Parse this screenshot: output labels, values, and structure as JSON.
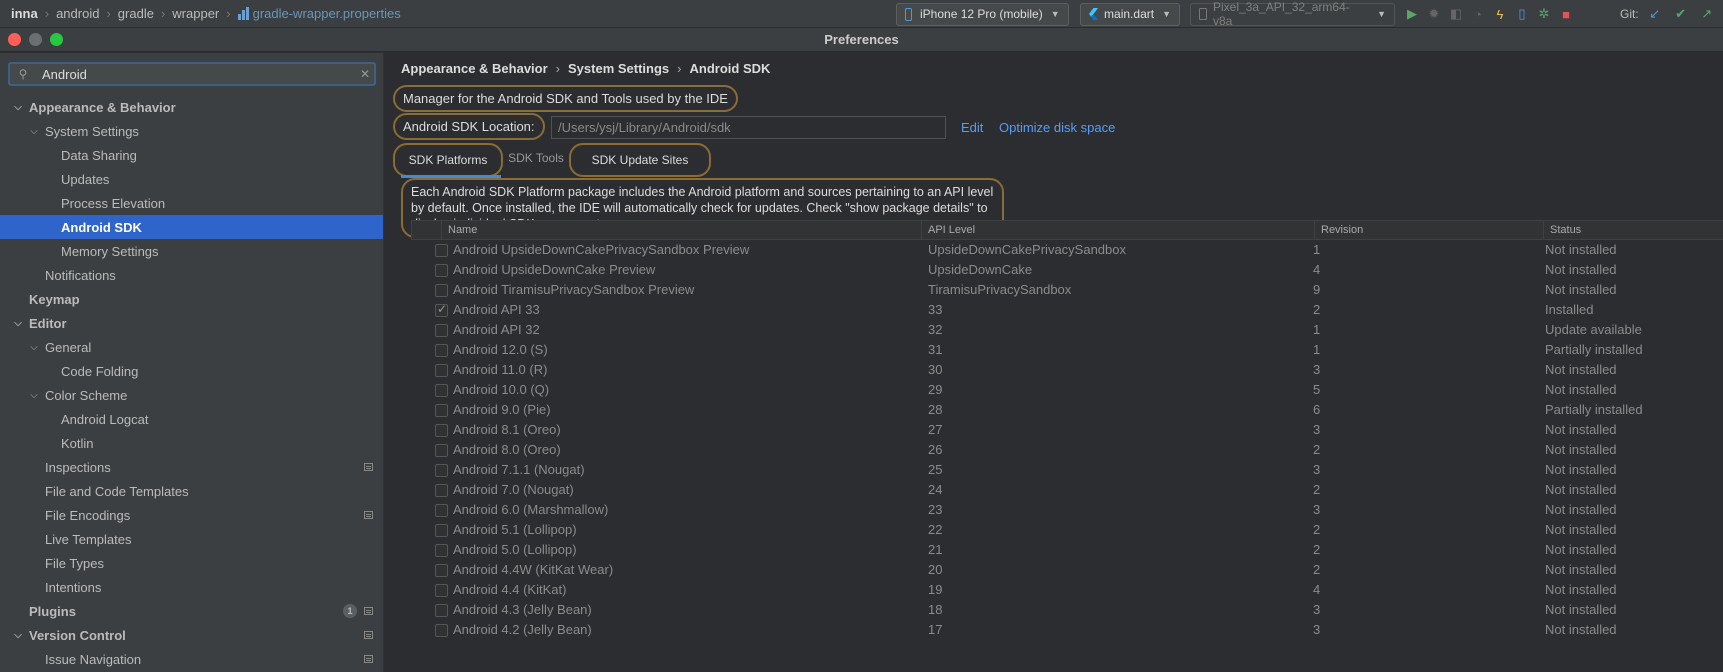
{
  "topbar": {
    "breadcrumbs": [
      "inna",
      "android",
      "gradle",
      "wrapper"
    ],
    "file": "gradle-wrapper.properties",
    "device_selector": "iPhone 12 Pro (mobile)",
    "run_config": "main.dart",
    "emulator": "Pixel_3a_API_32_arm64-v8a",
    "git_label": "Git:"
  },
  "window": {
    "title": "Preferences"
  },
  "sidebar": {
    "search_value": "Android",
    "items": [
      {
        "label": "Appearance & Behavior"
      },
      {
        "label": "System Settings"
      },
      {
        "label": "Data Sharing"
      },
      {
        "label": "Updates"
      },
      {
        "label": "Process Elevation"
      },
      {
        "label": "Android SDK"
      },
      {
        "label": "Memory Settings"
      },
      {
        "label": "Notifications"
      },
      {
        "label": "Keymap"
      },
      {
        "label": "Editor"
      },
      {
        "label": "General"
      },
      {
        "label": "Code Folding"
      },
      {
        "label": "Color Scheme"
      },
      {
        "label": "Android Logcat"
      },
      {
        "label": "Kotlin"
      },
      {
        "label": "Inspections"
      },
      {
        "label": "File and Code Templates"
      },
      {
        "label": "File Encodings"
      },
      {
        "label": "Live Templates"
      },
      {
        "label": "File Types"
      },
      {
        "label": "Intentions"
      },
      {
        "label": "Plugins",
        "badge": "1"
      },
      {
        "label": "Version Control"
      },
      {
        "label": "Issue Navigation"
      }
    ]
  },
  "content": {
    "breadcrumb": [
      "Appearance & Behavior",
      "System Settings",
      "Android SDK"
    ],
    "description": "Manager for the Android SDK and Tools used by the IDE",
    "sdk_location_label": "Android SDK Location:",
    "sdk_location_value": "/Users/ysj/Library/Android/sdk",
    "edit_link": "Edit",
    "optimize_link": "Optimize disk space",
    "tabs": [
      "SDK Platforms",
      "SDK Tools",
      "SDK Update Sites"
    ],
    "info": "Each Android SDK Platform package includes the Android platform and sources pertaining to an API level by default. Once installed, the IDE will automatically check for updates. Check \"show package details\" to display individual SDK components.",
    "table": {
      "headers": [
        "Name",
        "API Level",
        "Revision",
        "Status"
      ],
      "rows": [
        {
          "name": "Android UpsideDownCakePrivacySandbox Preview",
          "api": "UpsideDownCakePrivacySandbox",
          "rev": "1",
          "status": "Not installed",
          "checked": false
        },
        {
          "name": "Android UpsideDownCake Preview",
          "api": "UpsideDownCake",
          "rev": "4",
          "status": "Not installed",
          "checked": false
        },
        {
          "name": "Android TiramisuPrivacySandbox Preview",
          "api": "TiramisuPrivacySandbox",
          "rev": "9",
          "status": "Not installed",
          "checked": false
        },
        {
          "name": "Android API 33",
          "api": "33",
          "rev": "2",
          "status": "Installed",
          "checked": true
        },
        {
          "name": "Android API 32",
          "api": "32",
          "rev": "1",
          "status": "Update available",
          "checked": false
        },
        {
          "name": "Android 12.0 (S)",
          "api": "31",
          "rev": "1",
          "status": "Partially installed",
          "checked": false
        },
        {
          "name": "Android 11.0 (R)",
          "api": "30",
          "rev": "3",
          "status": "Not installed",
          "checked": false
        },
        {
          "name": "Android 10.0 (Q)",
          "api": "29",
          "rev": "5",
          "status": "Not installed",
          "checked": false
        },
        {
          "name": "Android 9.0 (Pie)",
          "api": "28",
          "rev": "6",
          "status": "Partially installed",
          "checked": false
        },
        {
          "name": "Android 8.1 (Oreo)",
          "api": "27",
          "rev": "3",
          "status": "Not installed",
          "checked": false
        },
        {
          "name": "Android 8.0 (Oreo)",
          "api": "26",
          "rev": "2",
          "status": "Not installed",
          "checked": false
        },
        {
          "name": "Android 7.1.1 (Nougat)",
          "api": "25",
          "rev": "3",
          "status": "Not installed",
          "checked": false
        },
        {
          "name": "Android 7.0 (Nougat)",
          "api": "24",
          "rev": "2",
          "status": "Not installed",
          "checked": false
        },
        {
          "name": "Android 6.0 (Marshmallow)",
          "api": "23",
          "rev": "3",
          "status": "Not installed",
          "checked": false
        },
        {
          "name": "Android 5.1 (Lollipop)",
          "api": "22",
          "rev": "2",
          "status": "Not installed",
          "checked": false
        },
        {
          "name": "Android 5.0 (Lollipop)",
          "api": "21",
          "rev": "2",
          "status": "Not installed",
          "checked": false
        },
        {
          "name": "Android 4.4W (KitKat Wear)",
          "api": "20",
          "rev": "2",
          "status": "Not installed",
          "checked": false
        },
        {
          "name": "Android 4.4 (KitKat)",
          "api": "19",
          "rev": "4",
          "status": "Not installed",
          "checked": false
        },
        {
          "name": "Android 4.3 (Jelly Bean)",
          "api": "18",
          "rev": "3",
          "status": "Not installed",
          "checked": false
        },
        {
          "name": "Android 4.2 (Jelly Bean)",
          "api": "17",
          "rev": "3",
          "status": "Not installed",
          "checked": false
        }
      ]
    }
  },
  "colors": {
    "accent": "#2f65ca",
    "link": "#589df6",
    "highlight_border": "#8a6c34",
    "traffic_red": "#ff5f57",
    "traffic_yellow": "#6e6e6e",
    "traffic_green": "#28c840"
  }
}
